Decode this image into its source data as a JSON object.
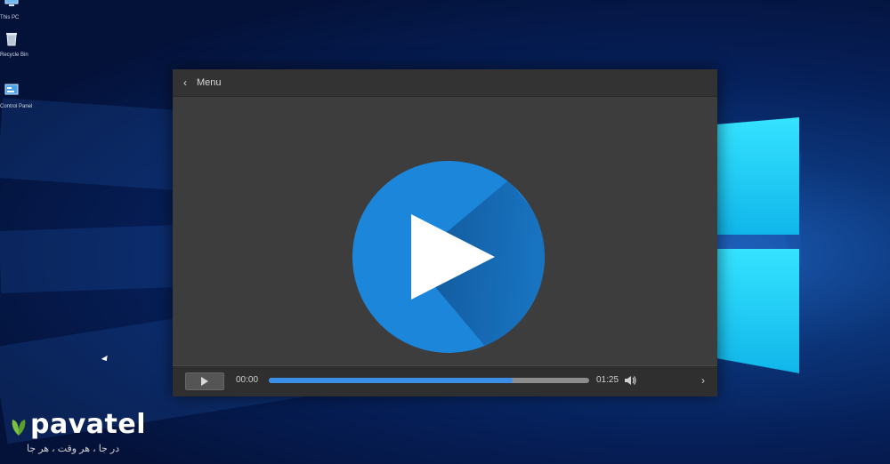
{
  "desktop": {
    "icons": [
      {
        "label": "This PC",
        "icon": "computer-icon"
      },
      {
        "label": "Recycle Bin",
        "icon": "recycle-bin-icon"
      },
      {
        "label": "Control Panel",
        "icon": "control-panel-icon"
      }
    ]
  },
  "player": {
    "menu_label": "Menu",
    "current_time": "00:00",
    "total_time": "01:25",
    "progress": 0.76,
    "colors": {
      "accent": "#1c86db",
      "progress": "#3b8ee8"
    }
  },
  "brand": {
    "name": "pavatel",
    "tagline": "در جا ، هر وقت ، هر جا"
  }
}
